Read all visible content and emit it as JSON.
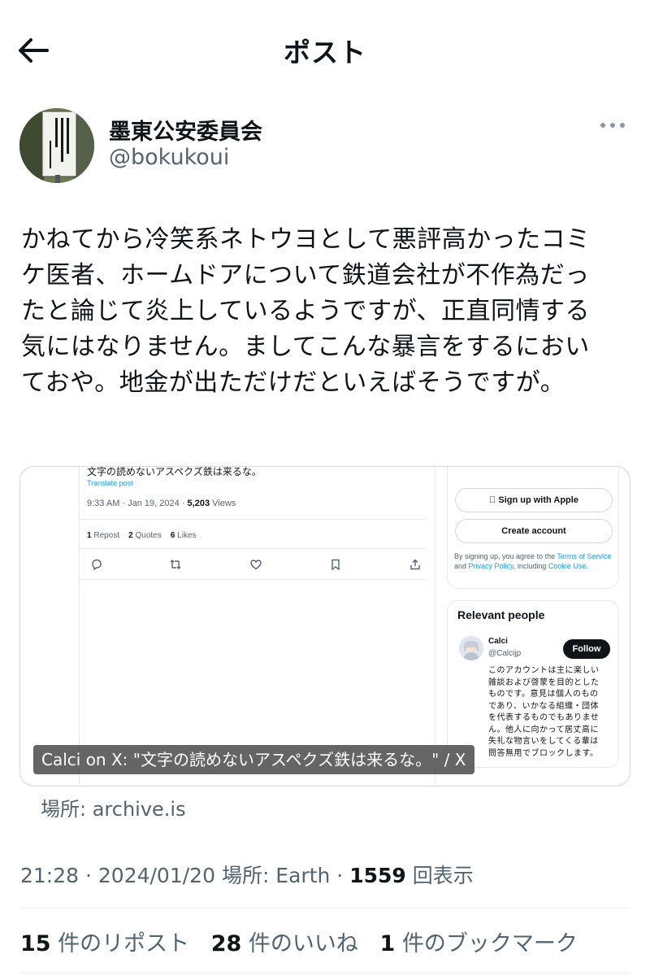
{
  "header": {
    "title": "ポスト"
  },
  "author": {
    "name": "墨東公安委員会",
    "handle": "@bokukoui",
    "avatar_sign_text": "線路内を耕作しないで下さい"
  },
  "post": {
    "text": "かねてから冷笑系ネトウヨとして悪評高かったコミ\nケ医者、ホームドアについて鉄道会社が不作為だっ\nたと論じて炎上しているようですが、正直同情する\n気にはなりません。ましてこんな暴言をするにおい\nておや。地金が出ただけだといえばそうですが。"
  },
  "card": {
    "caption": "Calci on X: \"文字の読めないアスペクズ鉄は来るな。\" / X",
    "shot": {
      "cut_text": "文字の読めないアスペクズ鉄は来るな。",
      "translate": "Translate post",
      "time": "9:33 AM · Jan 19, 2024 · ",
      "views_num": "5,203",
      "views_label": " Views",
      "repost_num": "1",
      "repost_label": " Repost",
      "quotes_num": "2",
      "quotes_label": " Quotes",
      "likes_num": "6",
      "likes_label": " Likes",
      "apple_btn": "Sign up with Apple",
      "create_btn": "Create account",
      "terms_1": "By signing up, you agree to the ",
      "terms_2": "Terms of",
      "terms_3": "Service",
      "terms_4": " and ",
      "terms_5": "Privacy Policy",
      "terms_6": ", including ",
      "terms_7": "Cookie",
      "terms_8": "Use.",
      "relevant": "Relevant people",
      "person_name": "Calci",
      "person_handle": "@Calcijp",
      "follow": "Follow",
      "bio": "このアカウントは主に楽しい\n雑談および啓蒙を目的とした\nものです。意見は個人のもの\nであり、いかなる組織・団体\nを代表するものでもありませ\nん。他人に向かって居丈高に\n失礼な物言いをしてくる輩は\n問答無用でブロックします。"
    }
  },
  "source": "場所: archive.is",
  "meta": {
    "time": "21:28 · 2024/01/20 ",
    "location": "場所: Earth",
    "sep": " · ",
    "views_num": "1559",
    "views_label": " 回表示"
  },
  "stats": {
    "reposts_num": "15",
    "reposts_label": " 件のリポスト",
    "likes_num": "28",
    "likes_label": " 件のいいね",
    "bookmarks_num": "1",
    "bookmarks_label": " 件のブックマーク"
  }
}
